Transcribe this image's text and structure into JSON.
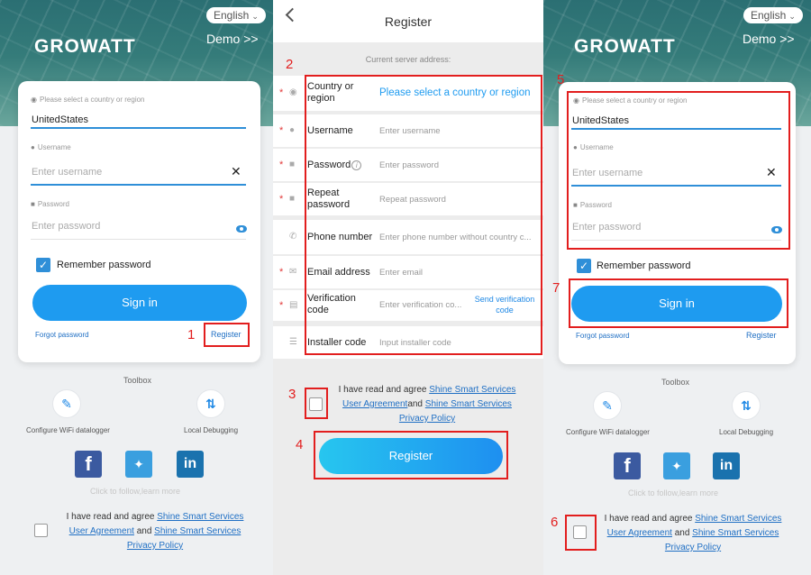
{
  "language": "English",
  "demo": "Demo >>",
  "logo": "GROWATT",
  "login": {
    "country_label": "Please select a country or region",
    "country_value": "UnitedStates",
    "username_label": "Username",
    "username_placeholder": "Enter username",
    "password_label": "Password",
    "password_placeholder": "Enter password",
    "remember": "Remember password",
    "sign_in": "Sign in",
    "forgot": "Forgot password",
    "register": "Register"
  },
  "toolbox": {
    "title": "Toolbox",
    "wifi": "Configure WiFi datalogger",
    "debug": "Local Debugging"
  },
  "follow": "Click to follow,learn more",
  "agreement": {
    "prefix": "I have read and agree ",
    "service1": "Shine Smart Services",
    "ua": "User Agreement",
    "and": " and ",
    "and_tight": "and ",
    "service2": "Shine Smart Services",
    "privacy": "Privacy Policy"
  },
  "register": {
    "title": "Register",
    "server": "Current server address:",
    "country_label": "Country or region",
    "country_placeholder": "Please select a country or region",
    "username_label": "Username",
    "username_placeholder": "Enter username",
    "password_label": "Password",
    "password_placeholder": "Enter password",
    "repeat_label": "Repeat password",
    "repeat_placeholder": "Repeat password",
    "phone_label": "Phone number",
    "phone_placeholder": "Enter phone number without country c...",
    "email_label": "Email address",
    "email_placeholder": "Enter email",
    "verify_label": "Verification code",
    "verify_placeholder": "Enter verification co...",
    "send_code": "Send verification code",
    "installer_label": "Installer code",
    "installer_placeholder": "Input installer code",
    "button": "Register"
  },
  "steps": [
    "1",
    "2",
    "3",
    "4",
    "5",
    "6",
    "7"
  ],
  "colors": {
    "accent": "#1e9bf0",
    "annotation": "#e21e1e",
    "brand_teal": "#357c7a"
  }
}
